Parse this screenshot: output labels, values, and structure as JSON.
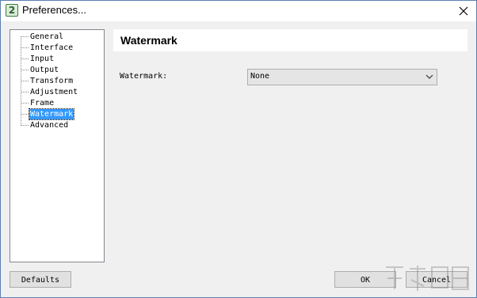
{
  "window": {
    "title": "Preferences...",
    "app_icon_glyph": "2"
  },
  "tree": {
    "items": [
      {
        "label": "General"
      },
      {
        "label": "Interface"
      },
      {
        "label": "Input"
      },
      {
        "label": "Output"
      },
      {
        "label": "Transform"
      },
      {
        "label": "Adjustment"
      },
      {
        "label": "Frame"
      },
      {
        "label": "Watermark",
        "selected": true
      },
      {
        "label": "Advanced"
      }
    ]
  },
  "panel": {
    "title": "Watermark",
    "field_label": "Watermark:",
    "dropdown_value": "None"
  },
  "buttons": {
    "defaults": "Defaults",
    "ok": "OK",
    "cancel": "Cancel"
  },
  "colors": {
    "selection": "#3399ff",
    "window_bg": "#f0f0f0"
  }
}
